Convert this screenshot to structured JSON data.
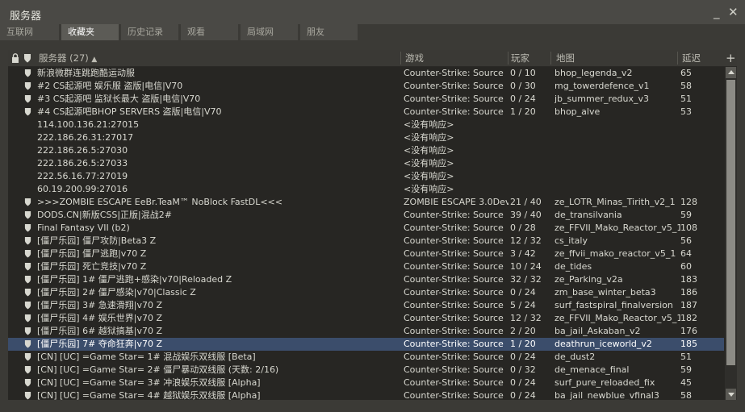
{
  "window": {
    "title": "服务器"
  },
  "tabs": [
    "互联网",
    "收藏夹",
    "历史记录",
    "观看",
    "局域网",
    "朋友"
  ],
  "header": {
    "server": "服务器 (27)",
    "game": "游戏",
    "players": "玩家",
    "map": "地图",
    "ping": "延迟",
    "add": "+"
  },
  "selected_row": 21,
  "servers": [
    {
      "name": "新浪微群连跳跑酷运动服",
      "game": "Counter-Strike: Source",
      "players": "0 / 10",
      "map": "bhop_legenda_v2",
      "ping": "65",
      "fav": true
    },
    {
      "name": "#2 CS起源吧 娱乐服 盗版|电信|V70",
      "game": "Counter-Strike: Source",
      "players": "0 / 30",
      "map": "mg_towerdefence_v1",
      "ping": "58",
      "fav": true
    },
    {
      "name": "#3 CS起源吧 监狱长最大 盗版|电信|V70",
      "game": "Counter-Strike: Source",
      "players": "0 / 24",
      "map": "jb_summer_redux_v3",
      "ping": "51",
      "fav": true
    },
    {
      "name": "#4 CS起源吧BHOP SERVERS 盗版|电信|V70",
      "game": "Counter-Strike: Source",
      "players": "1 / 20",
      "map": "bhop_alve",
      "ping": "53",
      "fav": true
    },
    {
      "name": "114.100.136.21:27015",
      "game": "<没有响应>",
      "players": "",
      "map": "",
      "ping": "",
      "fav": false
    },
    {
      "name": "222.186.26.31:27017",
      "game": "<没有响应>",
      "players": "",
      "map": "",
      "ping": "",
      "fav": false
    },
    {
      "name": "222.186.26.5:27030",
      "game": "<没有响应>",
      "players": "",
      "map": "",
      "ping": "",
      "fav": false
    },
    {
      "name": "222.186.26.5:27033",
      "game": "<没有响应>",
      "players": "",
      "map": "",
      "ping": "",
      "fav": false
    },
    {
      "name": "222.56.16.77:27019",
      "game": "<没有响应>",
      "players": "",
      "map": "",
      "ping": "",
      "fav": false
    },
    {
      "name": "60.19.200.99:27016",
      "game": "<没有响应>",
      "players": "",
      "map": "",
      "ping": "",
      "fav": false
    },
    {
      "name": ">>>ZOMBIE ESCAPE EeBr.TeaM™ NoBlock FastDL<<<",
      "game": "ZOMBIE ESCAPE 3.0Dev",
      "players": "21 / 40",
      "map": "ze_LOTR_Minas_Tirith_v2_1",
      "ping": "128",
      "fav": true
    },
    {
      "name": "DODS.CN|新版CSS|正版|混战2#",
      "game": "Counter-Strike: Source",
      "players": "39 / 40",
      "map": "de_transilvania",
      "ping": "59",
      "fav": true
    },
    {
      "name": "Final Fantasy VII (b2)",
      "game": "Counter-Strike: Source",
      "players": "0 / 28",
      "map": "ze_FFVII_Mako_Reactor_v5_1",
      "ping": "108",
      "fav": true
    },
    {
      "name": "[僵尸乐园] 僵尸攻防|Beta3 Z",
      "game": "Counter-Strike: Source",
      "players": "12 / 32",
      "map": "cs_italy",
      "ping": "56",
      "fav": true
    },
    {
      "name": "[僵尸乐园] 僵尸逃跑|v70 Z",
      "game": "Counter-Strike: Source",
      "players": "3 / 42",
      "map": "ze_ffvii_mako_reactor_v5_1",
      "ping": "64",
      "fav": true
    },
    {
      "name": "[僵尸乐园] 死亡竞技|v70 Z",
      "game": "Counter-Strike: Source",
      "players": "10 / 24",
      "map": "de_tides",
      "ping": "60",
      "fav": true
    },
    {
      "name": "[僵尸乐园] 1# 僵尸逃跑+感染|v70|Reloaded Z",
      "game": "Counter-Strike: Source",
      "players": "32 / 32",
      "map": "ze_Parking_v2a",
      "ping": "183",
      "fav": true
    },
    {
      "name": "[僵尸乐园] 2# 僵尸感染|v70|Classic Z",
      "game": "Counter-Strike: Source",
      "players": "0 / 24",
      "map": "zm_base_winter_beta3",
      "ping": "186",
      "fav": true
    },
    {
      "name": "[僵尸乐园] 3# 急速滑翔|v70 Z",
      "game": "Counter-Strike: Source",
      "players": "5 / 24",
      "map": "surf_fastspiral_finalversion",
      "ping": "187",
      "fav": true
    },
    {
      "name": "[僵尸乐园] 4# 娱乐世界|v70 Z",
      "game": "Counter-Strike: Source",
      "players": "12 / 32",
      "map": "ze_FFVII_Mako_Reactor_v5_1",
      "ping": "182",
      "fav": true
    },
    {
      "name": "[僵尸乐园] 6# 越狱搞基|v70 Z",
      "game": "Counter-Strike: Source",
      "players": "2 / 20",
      "map": "ba_jail_Askaban_v2",
      "ping": "176",
      "fav": true
    },
    {
      "name": "[僵尸乐园] 7# 夺命狂奔|v70 Z",
      "game": "Counter-Strike: Source",
      "players": "1 / 20",
      "map": "deathrun_iceworld_v2",
      "ping": "185",
      "fav": true
    },
    {
      "name": "[CN] [UC] =Game Star= 1# 混战娱乐双线服 [Beta]",
      "game": "Counter-Strike: Source",
      "players": "0 / 24",
      "map": "de_dust2",
      "ping": "51",
      "fav": true
    },
    {
      "name": "[CN] [UC] =Game Star= 2# 僵尸暴动双线服 (天数: 2/16)",
      "game": "Counter-Strike: Source",
      "players": "0 / 32",
      "map": "de_menace_final",
      "ping": "59",
      "fav": true
    },
    {
      "name": "[CN] [UC] =Game Star= 3# 冲浪娱乐双线服 [Alpha]",
      "game": "Counter-Strike: Source",
      "players": "0 / 24",
      "map": "surf_pure_reloaded_fix",
      "ping": "45",
      "fav": true
    },
    {
      "name": "[CN] [UC] =Game Star= 4# 越狱娱乐双线服 [Alpha]",
      "game": "Counter-Strike: Source",
      "players": "0 / 24",
      "map": "ba_jail_newblue_vfinal3",
      "ping": "58",
      "fav": true
    }
  ]
}
